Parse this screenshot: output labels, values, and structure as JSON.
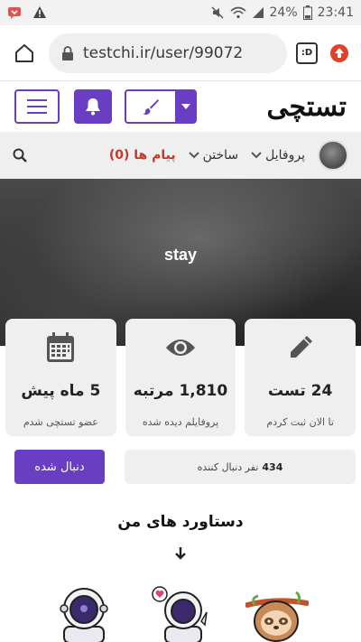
{
  "status_bar": {
    "battery": "24%",
    "time": "23:41"
  },
  "browser": {
    "url": "testchi.ir/user/99072",
    "tabs_label": ":D"
  },
  "site": {
    "logo": "تستچی"
  },
  "nav": {
    "profile": "پروفایل",
    "create": "ساختن",
    "messages": "پیام ها (0)"
  },
  "profile": {
    "name": "stay"
  },
  "stats": [
    {
      "value": "24 تست",
      "label": "تا الان ثبت کردم",
      "icon": "pencil-icon"
    },
    {
      "value": "1,810 مرتبه",
      "label": "پروفایلم دیده شده",
      "icon": "eye-icon"
    },
    {
      "value": "5 ماه پیش",
      "label": "عضو تستچی شدم",
      "icon": "calendar-icon"
    }
  ],
  "follow": {
    "button_label": "دنبال شده",
    "followers_count": "434",
    "followers_text": "نفر دنبال کننده"
  },
  "achievements": {
    "title": "دستاورد های من"
  },
  "colors": {
    "brand": "#6a3ec2",
    "accent_red": "#c0392b",
    "card_bg": "#efefef"
  }
}
